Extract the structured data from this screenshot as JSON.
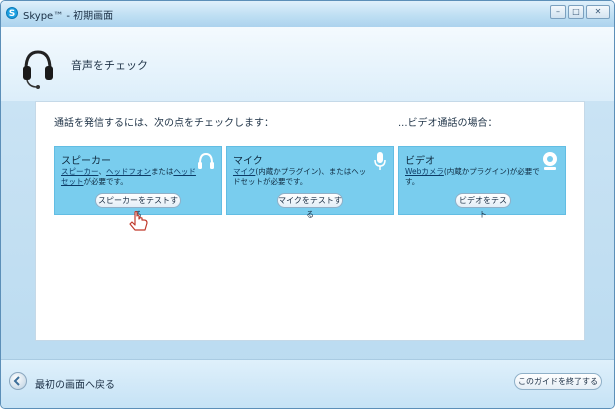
{
  "window": {
    "title": "Skype™ - 初期画面",
    "minimize": "–",
    "maximize": "□",
    "close": "✕"
  },
  "header": {
    "title": "音声をチェック",
    "icon": "headset-icon"
  },
  "main": {
    "intro": "通話を発信するには、次の点をチェックします：",
    "video_intro": "...ビデオ通話の場合：",
    "cards": [
      {
        "title": "スピーカー",
        "link1": "スピーカー",
        "sep1": "、",
        "link2": "ヘッドフォン",
        "sep2": "または",
        "link3": "ヘッドセット",
        "tail": "が必要です。",
        "button": "スピーカーをテストする",
        "icon": "headphones-icon"
      },
      {
        "title": "マイク",
        "link1": "マイク",
        "tail": "(内蔵かプラグイン)、またはヘッドセットが必要です。",
        "button": "マイクをテストする",
        "icon": "microphone-icon"
      },
      {
        "title": "ビデオ",
        "link1": "Webカメラ",
        "tail": "(内蔵かプラグイン)が必要です。",
        "button": "ビデオをテスト",
        "icon": "webcam-icon"
      }
    ]
  },
  "footer": {
    "back_label": "最初の画面へ戻る",
    "end_button": "このガイドを終了する"
  },
  "colors": {
    "card_bg": "#79cdee",
    "window_bg": "#b9daf0",
    "skype_blue": "#1ea1e2"
  }
}
